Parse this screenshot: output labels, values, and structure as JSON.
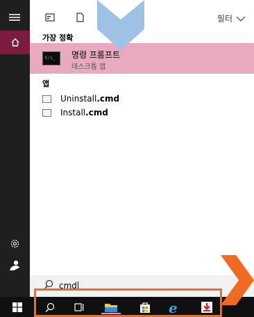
{
  "topbar": {
    "filter_label": "필터"
  },
  "sections": {
    "best_match": "가장 정확",
    "apps": "앱"
  },
  "best_match": {
    "title": "명령 프롬프트",
    "subtitle": "데스크톱 앱"
  },
  "apps": [
    {
      "name": "Uninstall",
      "ext": ".cmd"
    },
    {
      "name": "Install",
      "ext": ".cmd"
    }
  ],
  "search": {
    "value": "cmd"
  },
  "taskbar": {
    "items": [
      "windows-start",
      "search",
      "task-view",
      "file-explorer",
      "store",
      "edge",
      "app"
    ]
  },
  "colors": {
    "accent": "#7b1b40",
    "highlight": "#e8a8c0",
    "annotation": "#f06a22",
    "arrow_blue": "#9ec2e6"
  }
}
